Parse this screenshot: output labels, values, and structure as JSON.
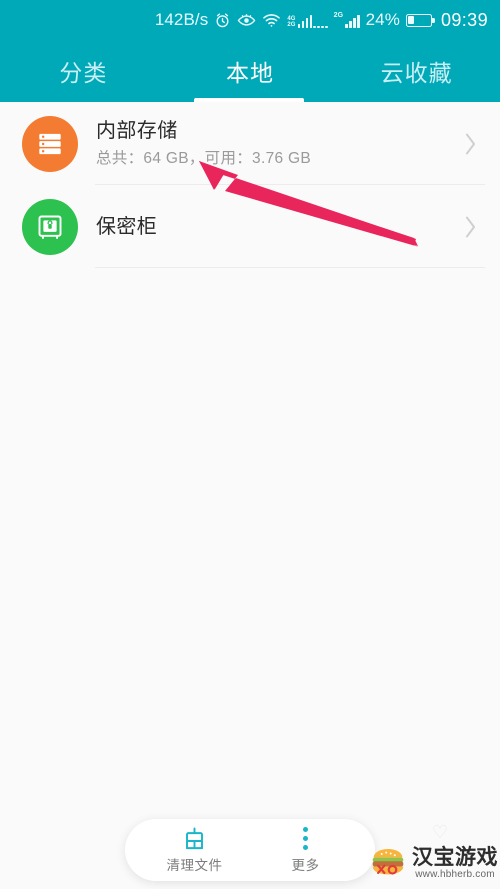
{
  "status_bar": {
    "net_speed": "142B/s",
    "icons": [
      "alarm-icon",
      "eye-icon",
      "wifi-icon",
      "signal-4g-icon",
      "signal-2g-icon"
    ],
    "signal_4g_label_top": "4G",
    "signal_4g_label_bottom": "2G",
    "signal_2g_label": "2G",
    "battery_percent": "24%",
    "clock": "09:39"
  },
  "tabs": [
    {
      "label": "分类",
      "active": false
    },
    {
      "label": "本地",
      "active": true
    },
    {
      "label": "云收藏",
      "active": false
    }
  ],
  "list": {
    "items": [
      {
        "title": "内部存储",
        "subtitle": "总共：64 GB，可用：3.76 GB",
        "icon": "storage-icon",
        "icon_color": "#f47c32"
      },
      {
        "title": "保密柜",
        "subtitle": "",
        "icon": "safe-lock-icon",
        "icon_color": "#2dc14f"
      }
    ]
  },
  "bottom_bar": {
    "items": [
      {
        "label": "清理文件",
        "icon": "broom-icon"
      },
      {
        "label": "更多",
        "icon": "more-vertical-icon"
      }
    ]
  },
  "watermark": {
    "title": "汉宝游戏",
    "url": "www.hbherb.com"
  },
  "colors": {
    "accent": "#00a9b8",
    "bottom_icon": "#19b6c9",
    "annotation_arrow": "#e8265c",
    "background": "#fafafa"
  }
}
